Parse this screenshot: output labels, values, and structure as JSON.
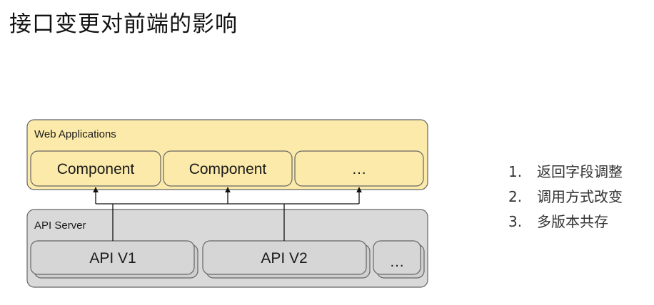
{
  "title": "接口变更对前端的影响",
  "web_panel": {
    "label": "Web Applications",
    "fill": "#fbeaa9",
    "components": [
      {
        "label": "Component"
      },
      {
        "label": "Component"
      },
      {
        "label": "…"
      }
    ]
  },
  "api_panel": {
    "label": "API Server",
    "fill": "#d9d9d9",
    "boxes": [
      {
        "label": "API V1"
      },
      {
        "label": "API V2"
      },
      {
        "label": "…"
      }
    ]
  },
  "impacts": [
    {
      "num": "1.",
      "text": "返回字段调整"
    },
    {
      "num": "2.",
      "text": "调用方式改变"
    },
    {
      "num": "3.",
      "text": "多版本共存"
    }
  ]
}
